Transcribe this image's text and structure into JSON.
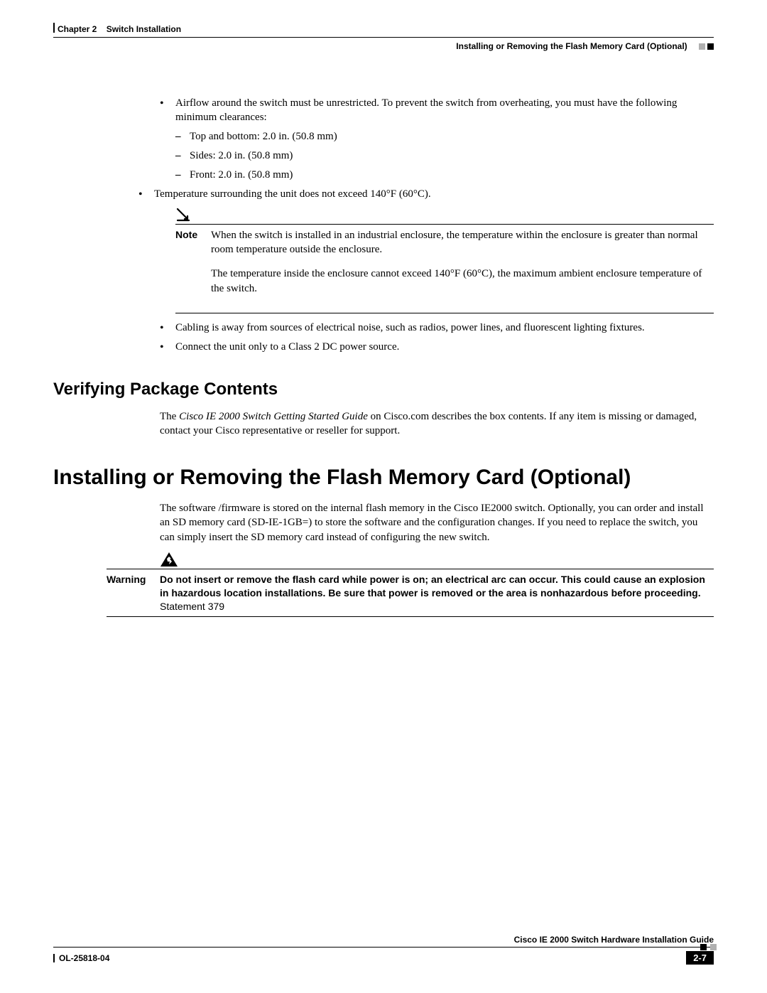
{
  "header": {
    "chapter_label": "Chapter 2",
    "chapter_title": "Switch Installation",
    "section_title": "Installing or Removing the Flash Memory Card (Optional)"
  },
  "body": {
    "b1": "Airflow around the switch must be unrestricted. To prevent the switch from overheating, you must have the following minimum clearances:",
    "b1a": "Top and bottom: 2.0 in. (50.8 mm)",
    "b1b": "Sides: 2.0 in. (50.8 mm)",
    "b1c": "Front: 2.0 in. (50.8 mm)",
    "b2": "Temperature surrounding the unit does not exceed 140°F (60°C).",
    "note_label": "Note",
    "note_p1": "When the switch is installed in an industrial enclosure, the temperature within the enclosure is greater than normal room temperature outside the enclosure.",
    "note_p2": "The temperature inside the enclosure cannot exceed 140°F (60°C), the maximum ambient enclosure temperature of the switch.",
    "b3": "Cabling is away from sources of electrical noise, such as radios, power lines, and fluorescent lighting fixtures.",
    "b4": "Connect the unit only to a Class 2 DC power source.",
    "h2": "Verifying Package Contents",
    "vpc_pre": "The ",
    "vpc_italic": "Cisco IE 2000 Switch Getting Started Guide",
    "vpc_post": " on Cisco.com describes the box contents. If any item is missing or damaged, contact your Cisco representative or reseller for support.",
    "h1": "Installing or Removing the Flash Memory Card (Optional)",
    "flash_p": "The software /firmware is stored on the internal flash memory in the Cisco IE2000 switch. Optionally, you can order and install an SD memory card (SD-IE-1GB=) to store the software and the configuration changes. If you need to replace the switch, you can simply insert the SD memory card instead of configuring the new switch.",
    "warn_label": "Warning",
    "warn_bold": "Do not insert or remove the flash card while power is on; an electrical arc can occur. This could cause an explosion in hazardous location installations. Be sure that power is removed or the area is nonhazardous before proceeding. ",
    "warn_norm": "Statement 379"
  },
  "footer": {
    "guide_title": "Cisco IE 2000 Switch Hardware Installation Guide",
    "doc_id": "OL-25818-04",
    "page_num": "2-7"
  }
}
